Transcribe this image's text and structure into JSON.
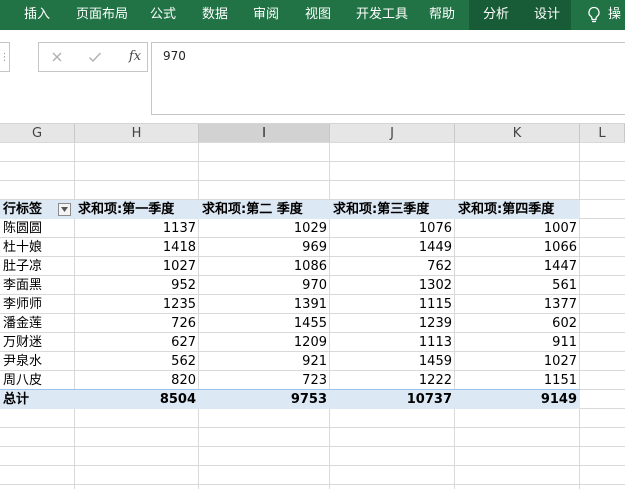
{
  "ribbon": {
    "tabs": [
      {
        "label": "插入",
        "name": "tab-insert",
        "contextual": false
      },
      {
        "label": "页面布局",
        "name": "tab-page-layout",
        "contextual": false
      },
      {
        "label": "公式",
        "name": "tab-formulas",
        "contextual": false
      },
      {
        "label": "数据",
        "name": "tab-data",
        "contextual": false
      },
      {
        "label": "审阅",
        "name": "tab-review",
        "contextual": false
      },
      {
        "label": "视图",
        "name": "tab-view",
        "contextual": false
      },
      {
        "label": "开发工具",
        "name": "tab-developer",
        "contextual": false
      },
      {
        "label": "帮助",
        "name": "tab-help",
        "contextual": false
      },
      {
        "label": "分析",
        "name": "tab-analyze",
        "contextual": true
      },
      {
        "label": "设计",
        "name": "tab-design",
        "contextual": true
      }
    ],
    "tell_me_fragment": "操",
    "bulb_icon": "lightbulb-icon"
  },
  "formula_bar": {
    "cancel_icon": "cancel-x-icon",
    "enter_icon": "checkmark-icon",
    "fx_label": "fx",
    "value": "970"
  },
  "columns": [
    {
      "label": "G",
      "selected": false
    },
    {
      "label": "H",
      "selected": false
    },
    {
      "label": "I",
      "selected": true
    },
    {
      "label": "J",
      "selected": false
    },
    {
      "label": "K",
      "selected": false
    },
    {
      "label": "L",
      "selected": false
    }
  ],
  "pivot": {
    "row_label_header": "行标签",
    "value_headers": [
      "求和项:第一季度",
      "求和项:第二 季度",
      "求和项:第三季度",
      "求和项:第四季度"
    ],
    "rows": [
      {
        "name": "陈圆圆",
        "values": [
          "1137",
          "1029",
          "1076",
          "1007"
        ]
      },
      {
        "name": "杜十娘",
        "values": [
          "1418",
          "969",
          "1449",
          "1066"
        ]
      },
      {
        "name": "肚子凉",
        "values": [
          "1027",
          "1086",
          "762",
          "1447"
        ]
      },
      {
        "name": "李面黑",
        "values": [
          "952",
          "970",
          "1302",
          "561"
        ]
      },
      {
        "name": "李师师",
        "values": [
          "1235",
          "1391",
          "1115",
          "1377"
        ]
      },
      {
        "name": "潘金莲",
        "values": [
          "726",
          "1455",
          "1239",
          "602"
        ]
      },
      {
        "name": "万财迷",
        "values": [
          "627",
          "1209",
          "1113",
          "911"
        ]
      },
      {
        "name": "尹泉水",
        "values": [
          "562",
          "921",
          "1459",
          "1027"
        ]
      },
      {
        "name": "周八皮",
        "values": [
          "820",
          "723",
          "1222",
          "1151"
        ]
      }
    ],
    "total_label": "总计",
    "totals": [
      "8504",
      "9753",
      "10737",
      "9149"
    ],
    "header_band_color": "#dde8f5",
    "filter_icon": "dropdown-filter-icon"
  },
  "colors": {
    "ribbon": "#217346",
    "ribbon_contextual": "#185c37",
    "gridline": "#d9d9d9",
    "pivot_band": "#dde8f5"
  }
}
